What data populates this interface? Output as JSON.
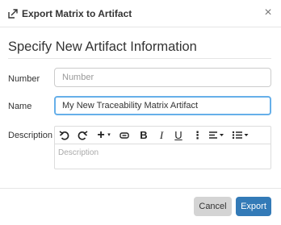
{
  "dialog": {
    "title": "Export Matrix to Artifact",
    "close_icon": "close-icon",
    "header_icon": "export-icon"
  },
  "form": {
    "section_title": "Specify New Artifact Information",
    "number": {
      "label": "Number",
      "value": "",
      "placeholder": "Number"
    },
    "name": {
      "label": "Name",
      "value": "My New Traceability Matrix Artifact"
    },
    "description": {
      "label": "Description",
      "placeholder": "Description",
      "toolbar": [
        "undo-icon",
        "redo-icon",
        "insert-plus-icon",
        "link-icon",
        "bold-icon",
        "italic-icon",
        "underline-icon",
        "more-vertical-icon",
        "align-icon",
        "list-icon"
      ],
      "toolbar_glyphs": {
        "insert": "+",
        "bold": "B",
        "italic": "I",
        "underline": "U",
        "more": "⋮"
      }
    }
  },
  "footer": {
    "cancel_label": "Cancel",
    "export_label": "Export"
  },
  "colors": {
    "primary": "#337ab7",
    "cancel_bg": "#d4d4d4",
    "focus_border": "#66afe9"
  }
}
